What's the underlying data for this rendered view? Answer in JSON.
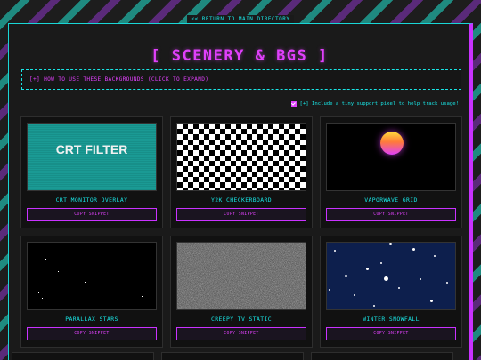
{
  "nav": {
    "return_label": "<< RETURN TO MAIN DIRECTORY"
  },
  "page": {
    "title": "[ SCENERY & BGS ]"
  },
  "howto": {
    "label": "[+] HOW TO USE THESE BACKGROUNDS (CLICK TO EXPAND)"
  },
  "support": {
    "label": "[+] Include a tiny support pixel to help track usage!",
    "checked": true
  },
  "cards": [
    {
      "label": "CRT MONITOR OVERLAY",
      "preview_text": "CRT FILTER",
      "button": "COPY SNIPPET"
    },
    {
      "label": "Y2K CHECKERBOARD",
      "button": "COPY SNIPPET"
    },
    {
      "label": "VAPORWAVE GRID",
      "button": "COPY SNIPPET"
    },
    {
      "label": "PARALLAX STARS",
      "button": "COPY SNIPPET"
    },
    {
      "label": "CREEPY TV STATIC",
      "button": "COPY SNIPPET"
    },
    {
      "label": "WINTER SNOWFALL",
      "button": "COPY SNIPPET"
    }
  ],
  "colors": {
    "accent_cyan": "#19e5e5",
    "accent_magenta": "#e040fb",
    "panel_bg": "#1a1a1a"
  }
}
